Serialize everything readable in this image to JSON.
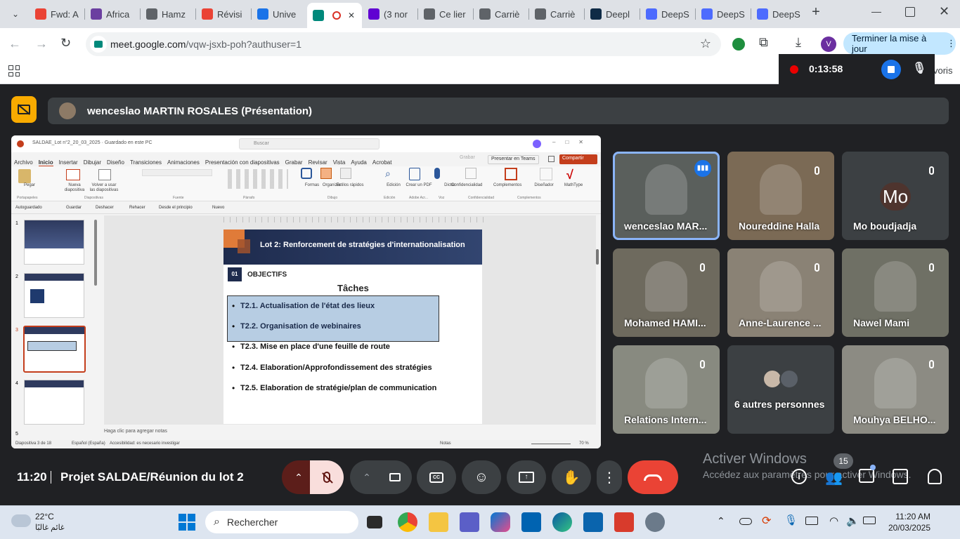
{
  "browser": {
    "tabs": [
      {
        "label": "Fwd: A",
        "color": "#ea4335"
      },
      {
        "label": "Africa",
        "color": "#6b3fa0"
      },
      {
        "label": "Hamz",
        "color": "#5f6368"
      },
      {
        "label": "Révisi",
        "color": "#ea4335"
      },
      {
        "label": "Unive",
        "color": "#1a73e8"
      },
      {
        "label": "",
        "color": "#00897b"
      },
      {
        "label": "(3 nor",
        "color": "#6001d2"
      },
      {
        "label": "Ce lier",
        "color": "#5f6368"
      },
      {
        "label": "Carriè",
        "color": "#5f6368"
      },
      {
        "label": "Carriè",
        "color": "#5f6368"
      },
      {
        "label": "Deepl",
        "color": "#0f2b46"
      },
      {
        "label": "DeepS",
        "color": "#4d6bfe"
      },
      {
        "label": "DeepS",
        "color": "#4d6bfe"
      },
      {
        "label": "DeepS",
        "color": "#4d6bfe"
      }
    ],
    "url_host": "meet.google.com",
    "url_path": "/vqw-jsxb-poh?authuser=1",
    "profile_initial": "V",
    "update_label": "Terminer la mise à jour",
    "bookmarks_tail": "voris"
  },
  "recording": {
    "time": "0:13:58"
  },
  "meet": {
    "presenter_label": "wenceslao MARTIN ROSALES (Présentation)",
    "participants": [
      {
        "name": "wenceslao MAR...",
        "speaking": true,
        "bg": "#5a5f5c"
      },
      {
        "name": "Noureddine Halla",
        "speaking": false,
        "bg": "#7b6a55"
      },
      {
        "name": "Mo boudjadja",
        "speaking": false,
        "bg": "#3c4043",
        "initials": "Mo"
      },
      {
        "name": "Mohamed HAMI...",
        "speaking": false,
        "bg": "#6e6a5e"
      },
      {
        "name": "Anne-Laurence ...",
        "speaking": false,
        "bg": "#8a8275"
      },
      {
        "name": "Nawel Mami",
        "speaking": false,
        "bg": "#6f7065"
      },
      {
        "name": "Relations Intern...",
        "speaking": false,
        "bg": "#888a80"
      },
      {
        "name": "6 autres personnes",
        "speaking": false,
        "bg": "#3c4043"
      },
      {
        "name": "Mouhya BELHO...",
        "speaking": false,
        "bg": "#8c8b83"
      }
    ],
    "time": "11:20",
    "meeting_title": "Projet SALDAE/Réunion du lot 2",
    "participant_count": "15",
    "activate_title": "Activer Windows",
    "activate_sub": "Accédez aux paramètres pour activer Windows."
  },
  "ppt": {
    "title_bar": "SALDAE_Lot n°2_20_03_2025 · Guardado en este PC",
    "search": "Buscar",
    "menu": [
      "Archivo",
      "Inicio",
      "Insertar",
      "Dibujar",
      "Diseño",
      "Transiciones",
      "Animaciones",
      "Presentación con diapositivas",
      "Grabar",
      "Revisar",
      "Vista",
      "Ayuda",
      "Acrobat"
    ],
    "present_teams": "Presentar en Teams",
    "share": "Compartir",
    "record": "Grabar",
    "ribbon_groups": [
      "Portapapeles",
      "Diapositivas",
      "Fuente",
      "Párrafo",
      "Dibujo",
      "Edición",
      "Adobe Acr...",
      "Voz",
      "Confidencialidad",
      "Complementos"
    ],
    "ribbon_buttons": [
      "Pegar",
      "Nueva diapositiva",
      "Volver a usar las diapositivas",
      "Formas",
      "Organizar",
      "Estilos rápidos",
      "Edición",
      "Crear un PDF",
      "Dictar",
      "Confidencialidad",
      "Complementos",
      "Diseñador",
      "MathType"
    ],
    "quick": [
      "Autoguardado",
      "Guardar",
      "Deshacer",
      "Rehacer",
      "Desde el principio",
      "Nuevo"
    ],
    "notes": "Haga clic para agregar notas",
    "status_left": "Diapositiva 3 de 18",
    "status_lang": "Español (España)",
    "status_access": "Accesibilidad: es necesario investigar",
    "status_notes": "Notas",
    "zoom": "70 %",
    "thumb_numbers": [
      "1",
      "2",
      "3",
      "4",
      "5"
    ],
    "slide": {
      "header": "Lot 2: Renforcement de stratégies d'internationalisation",
      "section_num": "01",
      "section": "OBJECTIFS",
      "subtitle": "Tâches",
      "items": [
        "T2.1. Actualisation de l'état des lieux",
        "T2.2. Organisation de webinaires",
        "T2.3. Mise en place d'une feuille de route",
        "T2.4. Elaboration/Approfondissement des stratégies",
        "T2.5. Elaboration de stratégie/plan de communication"
      ]
    }
  },
  "taskbar": {
    "weather_temp": "22°C",
    "weather_desc": "غائم غالبًا",
    "search_placeholder": "Rechercher",
    "clock_time": "11:20 AM",
    "clock_date": "20/03/2025"
  }
}
